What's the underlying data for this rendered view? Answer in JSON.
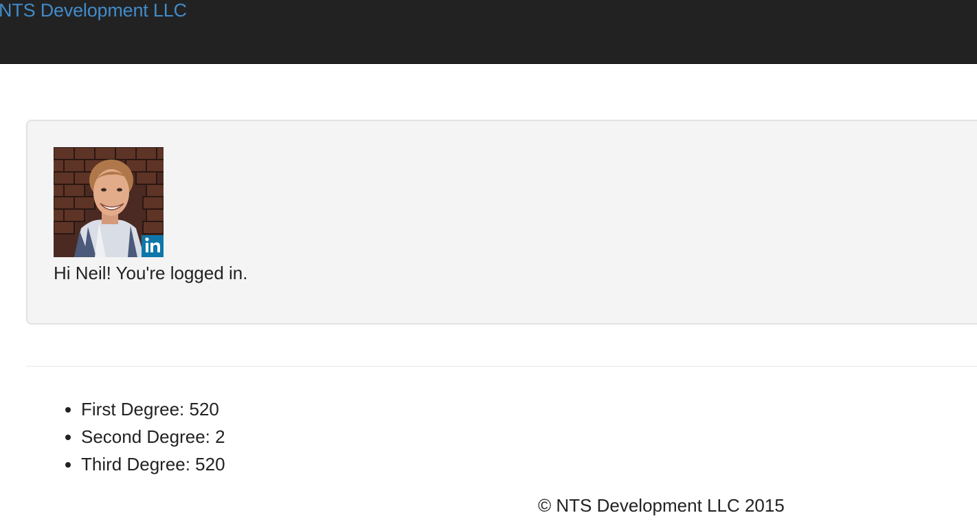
{
  "navbar": {
    "brand": "NTS Development LLC",
    "brand_color": "#428bca",
    "background": "#222222"
  },
  "profile": {
    "avatar_alt": "Profile photo",
    "badge_icon": "linkedin-icon",
    "badge_color": "#0e76a8",
    "greeting": "Hi Neil! You're logged in."
  },
  "connections": [
    "First Degree: 520",
    "Second Degree: 2",
    "Third Degree: 520"
  ],
  "footer": {
    "copyright": "© NTS Development LLC 2015"
  }
}
